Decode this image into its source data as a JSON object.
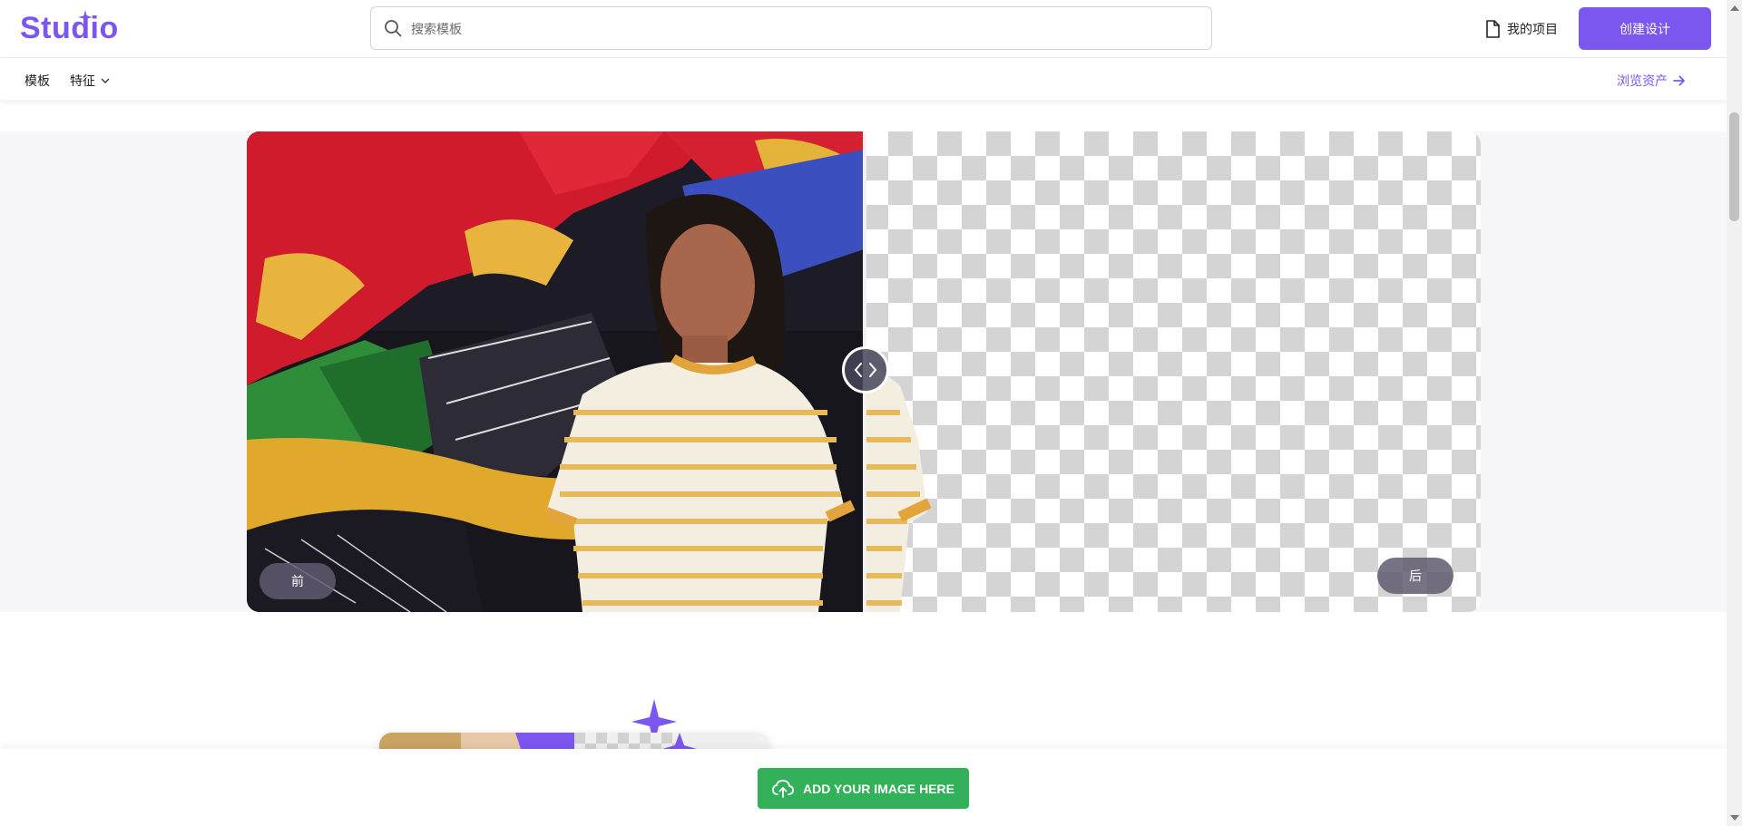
{
  "header": {
    "logo": "Studio",
    "search_placeholder": "搜索模板",
    "my_projects": "我的项目",
    "create_button": "创建设计"
  },
  "subnav": {
    "templates": "模板",
    "features": "特征",
    "browse_assets": "浏览资产"
  },
  "compare": {
    "before_label": "前",
    "after_label": "后"
  },
  "cta": {
    "label": "ADD YOUR IMAGE HERE"
  },
  "colors": {
    "brand": "#7b57f0",
    "cta": "#33b05a"
  },
  "icons": [
    "search-icon",
    "document-icon",
    "arrow-right-icon",
    "chevron-down-icon",
    "upload-cloud-icon",
    "sparkle-icon"
  ]
}
